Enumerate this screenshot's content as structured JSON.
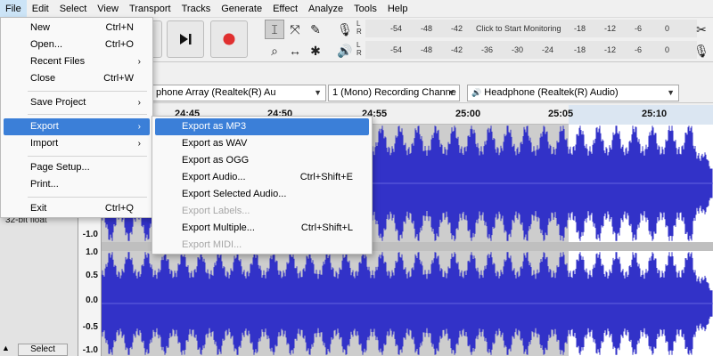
{
  "menubar": [
    "File",
    "Edit",
    "Select",
    "View",
    "Transport",
    "Tracks",
    "Generate",
    "Effect",
    "Analyze",
    "Tools",
    "Help"
  ],
  "meter": {
    "rec_ticks": [
      "-54",
      "-48",
      "-42",
      "-18",
      "-12",
      "-6",
      "0"
    ],
    "rec_prompt": "Click to Start Monitoring",
    "play_ticks": [
      "-54",
      "-48",
      "-42",
      "-36",
      "-30",
      "-24",
      "-18",
      "-12",
      "-6",
      "0"
    ],
    "lr": [
      "L",
      "R"
    ]
  },
  "devices": {
    "input": "phone Array (Realtek(R) Au",
    "channels": "1 (Mono) Recording Channe",
    "output": "Headphone (Realtek(R) Audio)"
  },
  "timeline": [
    "24:45",
    "24:50",
    "24:55",
    "25:00",
    "25:05",
    "25:10"
  ],
  "track": {
    "format": "32-bit float",
    "select_label": "Select"
  },
  "scale": [
    "-1.0",
    "1.0",
    "0.5",
    "0.0",
    "-0.5",
    "-1.0"
  ],
  "file_menu": [
    {
      "label": "New",
      "accel": "Ctrl+N"
    },
    {
      "label": "Open...",
      "accel": "Ctrl+O"
    },
    {
      "label": "Recent Files",
      "submenu": true
    },
    {
      "label": "Close",
      "accel": "Ctrl+W"
    },
    {
      "label": "Save Project",
      "submenu": true
    },
    {
      "label": "Export",
      "submenu": true
    },
    {
      "label": "Import",
      "submenu": true
    },
    {
      "label": "Page Setup..."
    },
    {
      "label": "Print..."
    },
    {
      "label": "Exit",
      "accel": "Ctrl+Q"
    }
  ],
  "export_menu": [
    {
      "label": "Export as MP3"
    },
    {
      "label": "Export as WAV"
    },
    {
      "label": "Export as OGG"
    },
    {
      "label": "Export Audio...",
      "accel": "Ctrl+Shift+E"
    },
    {
      "label": "Export Selected Audio..."
    },
    {
      "label": "Export Labels..."
    },
    {
      "label": "Export Multiple...",
      "accel": "Ctrl+Shift+L"
    },
    {
      "label": "Export MIDI..."
    }
  ],
  "colors": {
    "wave": "#3232c8",
    "highlight": "#3b7fd8",
    "record": "#e03030"
  }
}
